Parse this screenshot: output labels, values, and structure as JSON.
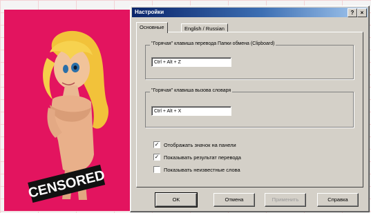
{
  "illustration": {
    "censor_label": "CENSORED",
    "background_color": "#e3145f"
  },
  "window": {
    "title": "Настройки",
    "help_button": "?",
    "close_button": "×",
    "tabs": [
      {
        "label": "Основные",
        "active": true
      },
      {
        "label": "English / Russian",
        "active": false
      }
    ],
    "groups": [
      {
        "legend": "\"Горячая\" клавиша перевода Папки обмена (Clipboard)",
        "hotkey_value": "Ctrl + Alt + Z"
      },
      {
        "legend": "\"Горячая\" клавиша вызова словаря",
        "hotkey_value": "Ctrl + Alt + X"
      }
    ],
    "checkboxes": [
      {
        "label": "Отображать значок на панели",
        "checked": true
      },
      {
        "label": "Показывать результат перевода",
        "checked": true
      },
      {
        "label": "Показывать неизвестные слова",
        "checked": false
      }
    ],
    "buttons": {
      "ok": "OK",
      "cancel": "Отмена",
      "apply": "Применить",
      "help": "Справка"
    }
  }
}
